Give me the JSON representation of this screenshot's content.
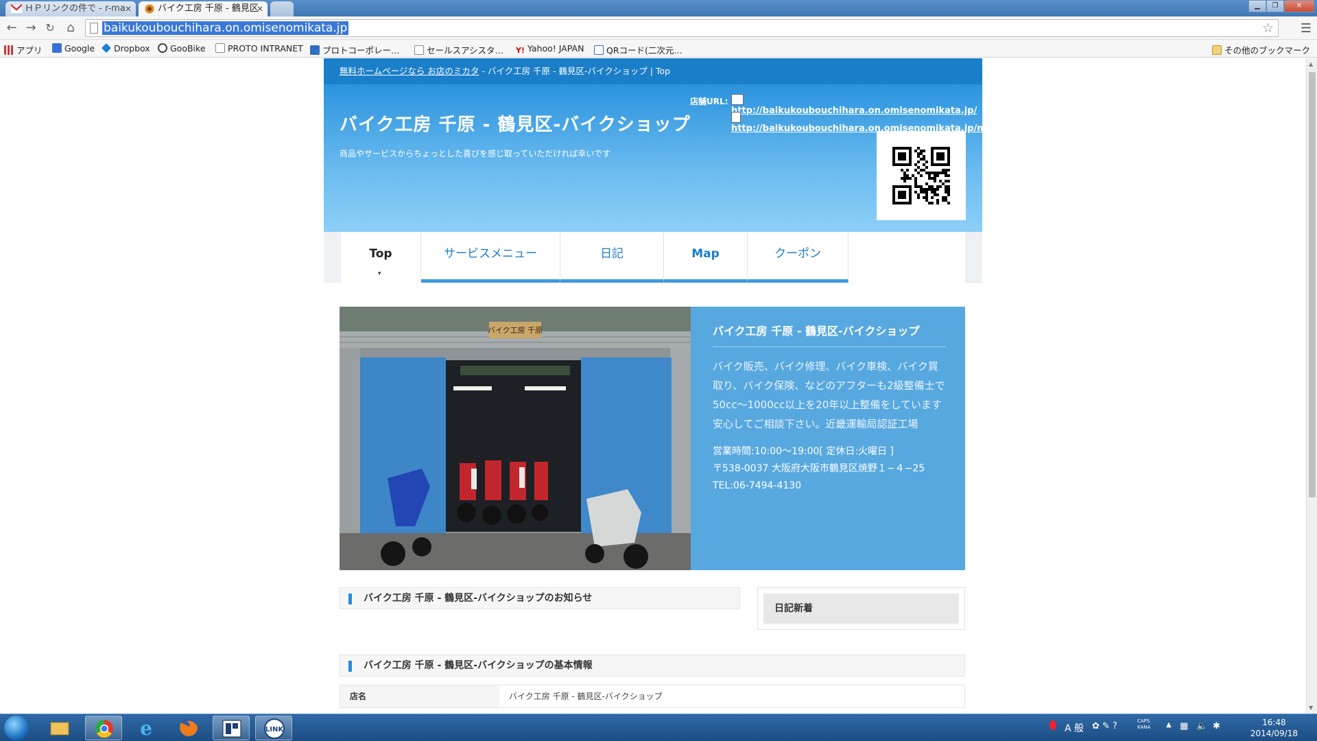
{
  "browser": {
    "tabs": [
      {
        "label": "ＨＰリンクの件で - r-ma",
        "active": false
      },
      {
        "label": "バイク工房 千原 - 鶴見区",
        "active": true
      }
    ],
    "url": "baikukoubouchihara.on.omisenomikata.jp",
    "bookmarks": [
      {
        "label": "アプリ",
        "icon": "apps-grid-icon"
      },
      {
        "label": "Google",
        "icon": "google-icon"
      },
      {
        "label": "Dropbox",
        "icon": "dropbox-icon"
      },
      {
        "label": "GooBike",
        "icon": "goobike-icon"
      },
      {
        "label": "PROTO INTRANET",
        "icon": "page-icon"
      },
      {
        "label": "プロトコーポレー…",
        "icon": "calendar-icon"
      },
      {
        "label": "セールスアシスタ…",
        "icon": "page-icon"
      },
      {
        "label": "Yahoo! JAPAN",
        "icon": "yahoo-icon"
      },
      {
        "label": "QRコード(二次元…",
        "icon": "qr-site-icon"
      }
    ],
    "other_bookmarks": "その他のブックマーク"
  },
  "site": {
    "breadcrumb": {
      "link": "無料ホームページなら お店のミカタ",
      "rest": " - バイク工房 千原 - 鶴見区-バイクショップ | Top"
    },
    "title": "バイク工房 千原 - 鶴見区-バイクショップ",
    "description": "商品やサービスからちょっとした喜びを感じ取っていただければ幸いです",
    "store_url_label": "店舗URL:",
    "pc_url": "http://baikukoubouchihara.on.omisenomikata.jp/",
    "mobile_url": "http://baikukoubouchihara.on.omisenomikata.jp/m/",
    "nav": [
      {
        "label": "Top",
        "current": true
      },
      {
        "label": "サービスメニュー",
        "current": false
      },
      {
        "label": "日記",
        "current": false
      },
      {
        "label": "Map",
        "current": false
      },
      {
        "label": "クーポン",
        "current": false
      }
    ],
    "hero": {
      "sign": "バイク工房 千原",
      "title": "バイク工房 千原 - 鶴見区-バイクショップ",
      "body": "バイク販売、バイク修理、バイク車検、バイク買取り、バイク保険、などのアフターも2級整備士で50cc～1000cc以上を20年以上整備をしています安心してご相談下さい。近畿運輸局認証工場",
      "hours": "営業時間:10:00～19:00[ 定休日:火曜日 ]",
      "address": "〒538-0037 大阪府大阪市鶴見区焼野１−４−25",
      "tel": "TEL:06-7494-4130"
    },
    "news_heading": "バイク工房 千原 - 鶴見区-バイクショップのお知らせ",
    "diary_heading": "日記新着",
    "info_heading": "バイク工房 千原 - 鶴見区-バイクショップの基本情報",
    "info_rows": [
      {
        "label": "店名",
        "value": "バイク工房 千原 - 鶴見区-バイクショップ"
      }
    ]
  },
  "taskbar": {
    "clock_time": "16:48",
    "clock_date": "2014/09/18",
    "ime": "A 般",
    "caps": "CAPS",
    "kana": "KANA"
  }
}
